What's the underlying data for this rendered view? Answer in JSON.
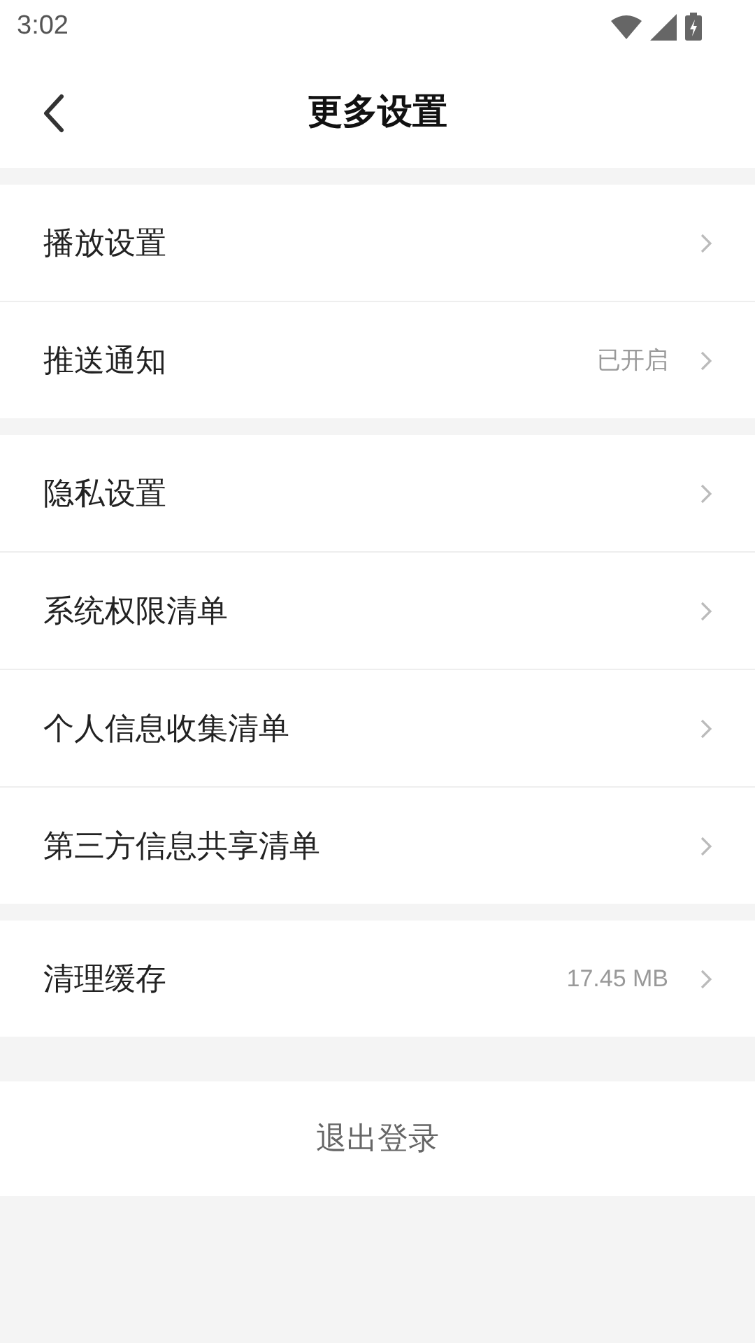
{
  "status_bar": {
    "time": "3:02"
  },
  "header": {
    "title": "更多设置"
  },
  "groups": [
    {
      "items": [
        {
          "label": "播放设置"
        },
        {
          "label": "推送通知",
          "value": "已开启"
        }
      ]
    },
    {
      "items": [
        {
          "label": "隐私设置"
        },
        {
          "label": "系统权限清单"
        },
        {
          "label": "个人信息收集清单"
        },
        {
          "label": "第三方信息共享清单"
        }
      ]
    },
    {
      "items": [
        {
          "label": "清理缓存",
          "value": "17.45 MB"
        }
      ]
    }
  ],
  "logout": {
    "label": "退出登录"
  }
}
